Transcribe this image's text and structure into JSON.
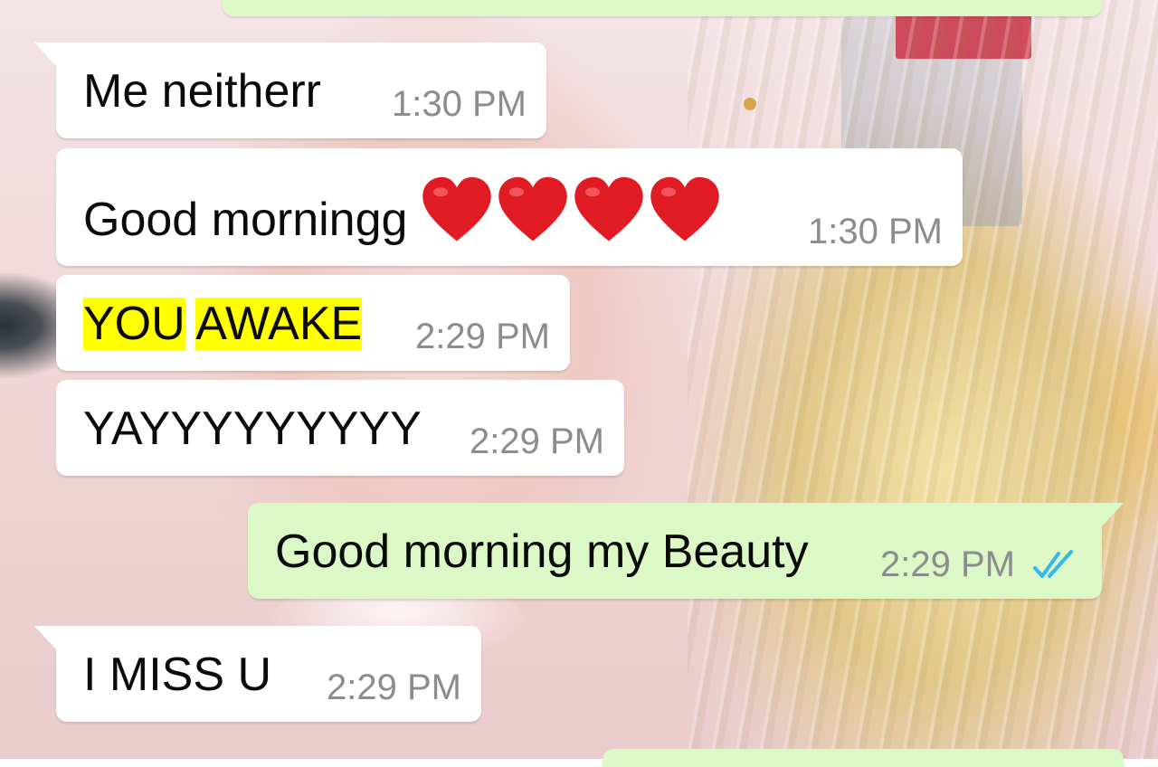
{
  "colors": {
    "incoming_bubble": "#ffffff",
    "outgoing_bubble": "#dcf8c6",
    "timestamp": "#8c8c8c",
    "read_ticks": "#34b7f1",
    "search_highlight": "#ffff00",
    "heart": "#e01b24"
  },
  "icons": {
    "heart": "red-heart-icon",
    "read_receipt": "double-check-read-icon"
  },
  "messages": [
    {
      "direction": "in",
      "text": "Me neitherr",
      "time": "1:30 PM"
    },
    {
      "direction": "in",
      "text": "Good morningg",
      "emoji_count": 4,
      "time": "1:30 PM"
    },
    {
      "direction": "in",
      "highlighted_words": [
        "YOU",
        "AWAKE"
      ],
      "time": "2:29 PM"
    },
    {
      "direction": "in",
      "text": "YAYYYYYYYYY",
      "time": "2:29 PM"
    },
    {
      "direction": "out",
      "text": "Good morning my Beauty",
      "time": "2:29 PM",
      "status": "read"
    },
    {
      "direction": "in",
      "text": "I MISS U",
      "time": "2:29 PM"
    }
  ]
}
